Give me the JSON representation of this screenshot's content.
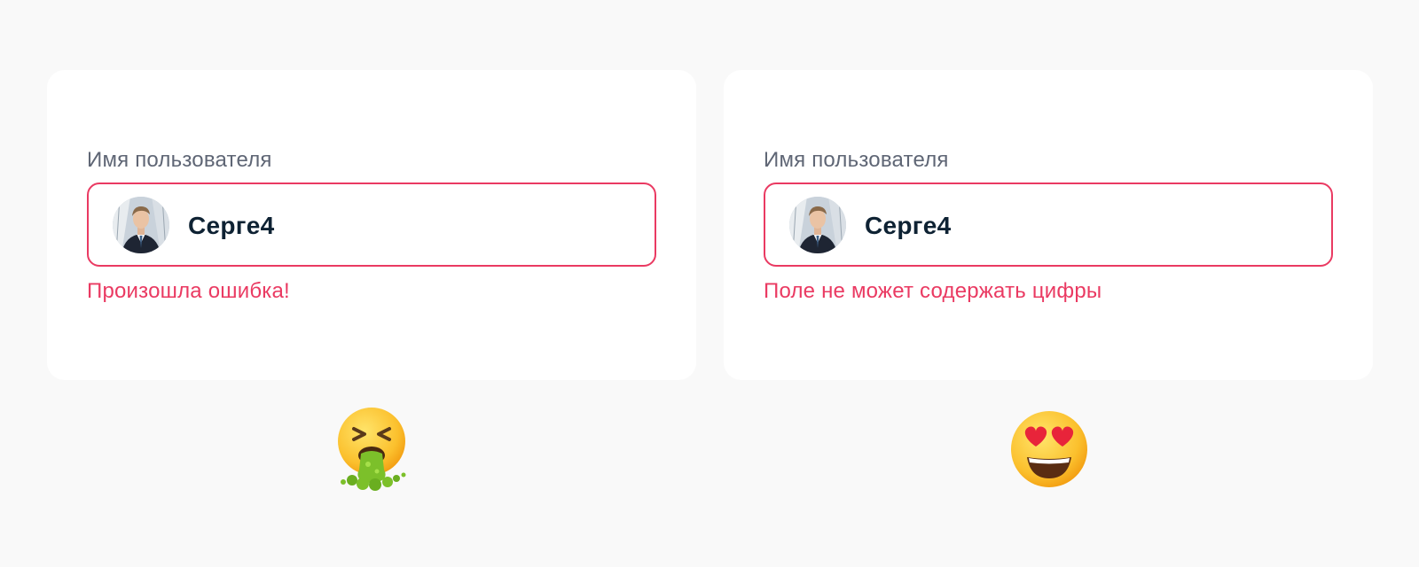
{
  "examples": [
    {
      "label": "Имя пользователя",
      "value": "Серге4",
      "error": "Произошла ошибка!",
      "reaction_icon": "nauseated-vomiting-face-emoji"
    },
    {
      "label": "Имя пользователя",
      "value": "Серге4",
      "error": "Поле не может содержать цифры",
      "reaction_icon": "heart-eyes-face-emoji"
    }
  ],
  "colors": {
    "background": "#f9f9f9",
    "card": "#ffffff",
    "error": "#ea3a62",
    "label": "#5f6675",
    "value": "#0e2233"
  }
}
